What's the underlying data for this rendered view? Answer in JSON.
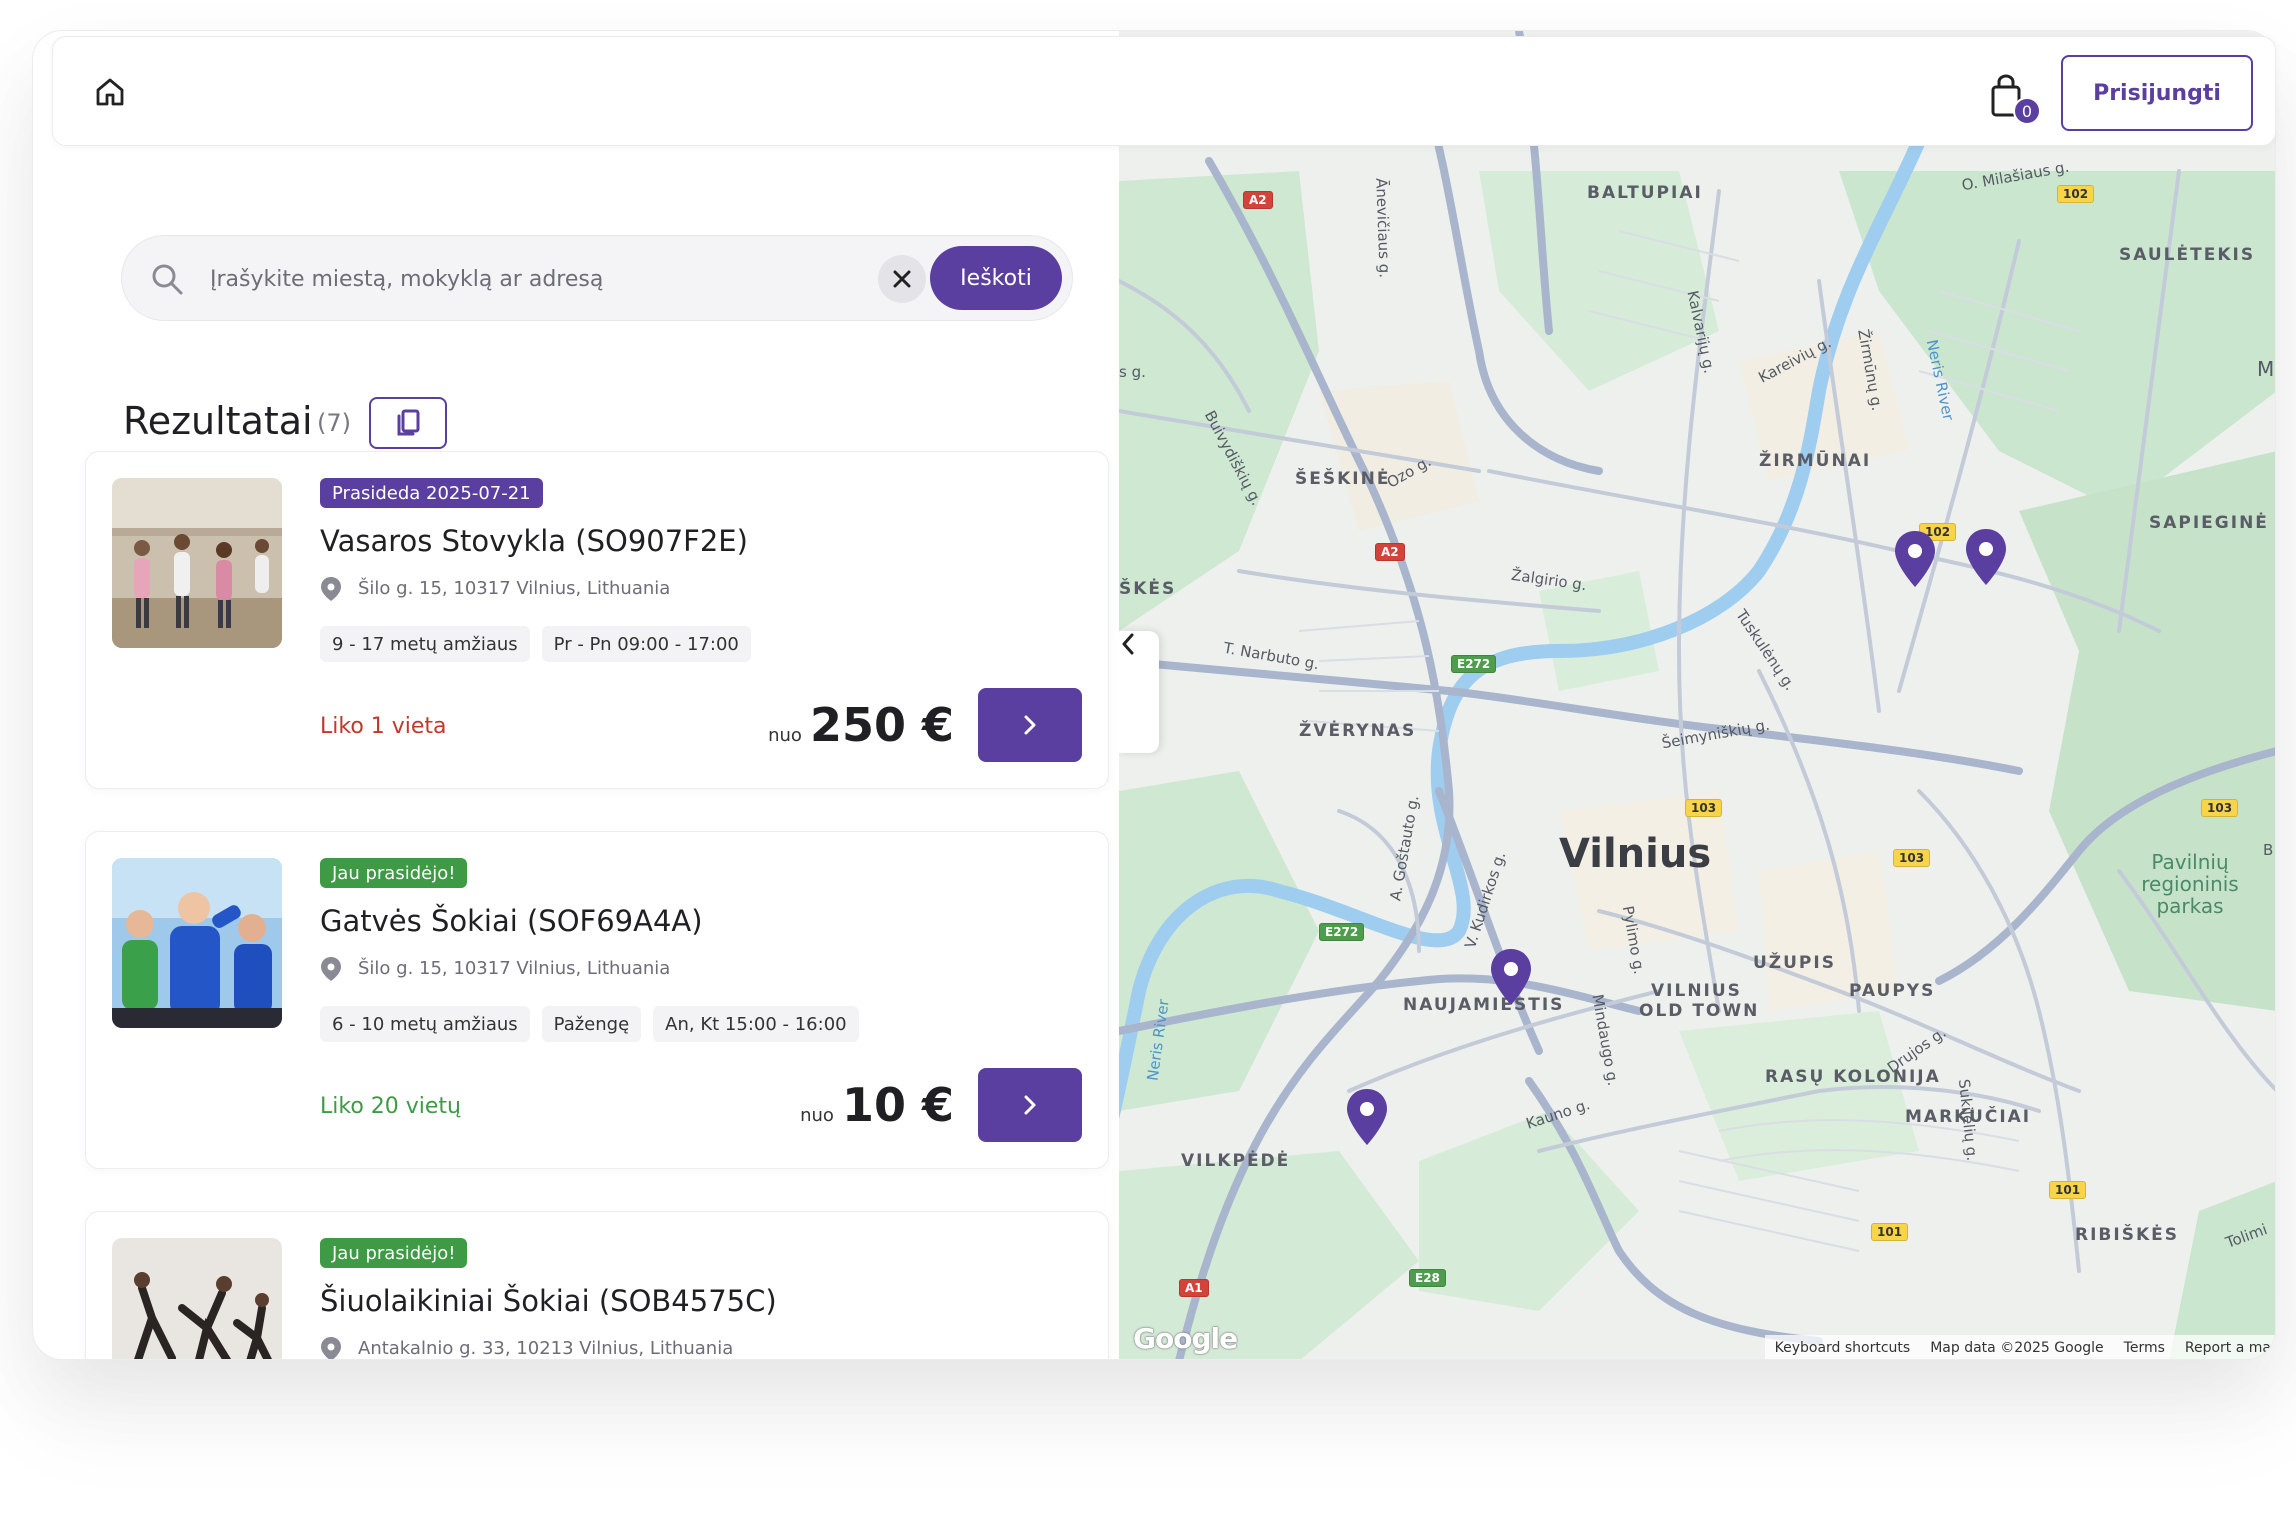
{
  "header": {
    "login_label": "Prisijungti",
    "cart_count": "0"
  },
  "search": {
    "placeholder": "Įrašykite miestą, mokyklą ar adresą",
    "button_label": "Ieškoti"
  },
  "results": {
    "title": "Rezultatai",
    "count": "(7)"
  },
  "cards": [
    {
      "badge": "Prasideda 2025-07-21",
      "badge_color": "#5b3fa0",
      "title": "Vasaros Stovykla (SO907F2E)",
      "address": "Šilo g. 15, 10317 Vilnius, Lithuania",
      "tags": [
        "9 - 17 metų amžiaus",
        "Pr - Pn 09:00 - 17:00"
      ],
      "availability": "Liko 1 vieta",
      "availability_color": "#c0392b",
      "price_prefix": "nuo",
      "price": "250 €"
    },
    {
      "badge": "Jau prasidėjo!",
      "badge_color": "#3f9a46",
      "title": "Gatvės Šokiai (SOF69A4A)",
      "address": "Šilo g. 15, 10317 Vilnius, Lithuania",
      "tags": [
        "6 - 10 metų amžiaus",
        "Pažengę",
        "An, Kt 15:00 - 16:00"
      ],
      "availability": "Liko 20 vietų",
      "availability_color": "#3f9a46",
      "price_prefix": "nuo",
      "price": "10 €"
    },
    {
      "badge": "Jau prasidėjo!",
      "badge_color": "#3f9a46",
      "title": "Šiuolaikiniai Šokiai (SOB4575C)",
      "address": "Antakalnio g. 33, 10213 Vilnius, Lithuania",
      "tags": [],
      "availability": "",
      "availability_color": "#3f9a46",
      "price_prefix": "",
      "price": ""
    }
  ],
  "map": {
    "city": "Vilnius",
    "districts": [
      "BALTUPIAI",
      "SAULĖTEKIS",
      "ŠEŠKINĖ",
      "ŽIRMŪNAI",
      "SAPIEGINĖ",
      "ŠKĖS",
      "ŽVĖRYNAS",
      "UŽUPIS",
      "PAUPYS",
      "NAUJAMIESTIS",
      "VILNIUS",
      "OLD TOWN",
      "RASŲ KOLONIJA",
      "MARKUČIAI",
      "VILKPĖDĖ",
      "RIBIŠKĖS"
    ],
    "streets": [
      "O. Milašiaus g.",
      "Kareivių g.",
      "Kalvarijų g.",
      "Žirmūnų g.",
      "Neris River",
      "Buivydiškių g.",
      "Ozo g.",
      "Žalgirio g.",
      "T. Narbuto g.",
      "Tuskulėnų g.",
      "Šeimyniškių g.",
      "A. Goštauto g.",
      "V. Kudirkos g.",
      "Pylimo g.",
      "Mindaugo g.",
      "Drujos g.",
      "Sukilėlių g.",
      "Kauno g.",
      "Tolimi",
      "Mi",
      "B",
      "s g.",
      "Neris River",
      "Ānevičiaus g."
    ],
    "park": "Pavilnių regioninis parkas",
    "route_badges": [
      "A2",
      "A2",
      "102",
      "102",
      "E272",
      "E272",
      "103",
      "103",
      "103",
      "101",
      "101",
      "A1",
      "E28"
    ],
    "google_logo": "Google",
    "footer": [
      "Keyboard shortcuts",
      "Map data ©2025 Google",
      "Terms",
      "Report a ma"
    ]
  },
  "icons": {
    "home": "home-icon",
    "cart": "shopping-bag-icon",
    "search": "search-icon",
    "clear": "close-icon",
    "copy": "copy-icon",
    "location": "location-pin-icon",
    "arrow": "chevron-right-icon",
    "collapse": "chevron-left-icon"
  },
  "colors": {
    "accent": "#5b3fa0",
    "pin": "#5b3fa0",
    "success": "#3f9a46",
    "danger": "#c0392b"
  }
}
